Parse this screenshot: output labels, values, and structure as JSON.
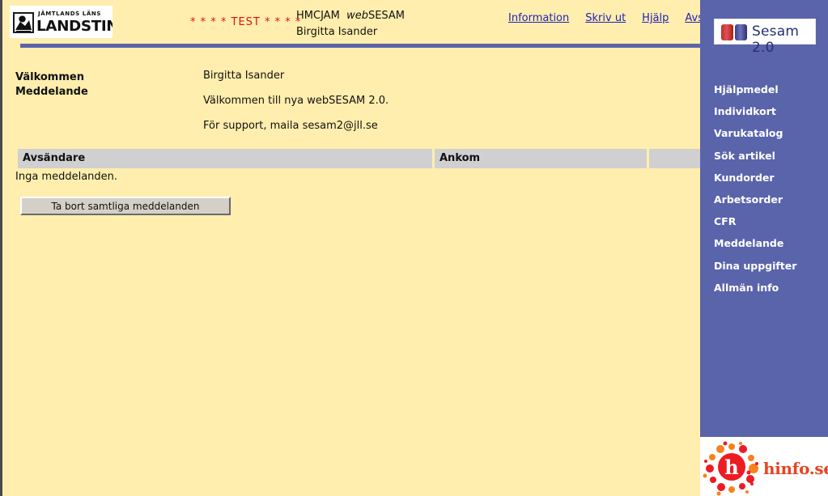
{
  "header": {
    "logo": {
      "line_top": "JÄMTLANDS LÄNS",
      "line_main": "LANDSTING",
      "icon": "landsting-emblem-icon"
    },
    "test_banner": "* * * *  TEST  * * * *",
    "unit_code": "HMCJAM",
    "app_name_italic": "web",
    "app_name_rest": "SESAM",
    "user_name": "Birgitta Isander",
    "nav_links": [
      {
        "label": "Information",
        "name": "nav-link-information"
      },
      {
        "label": "Skriv ut",
        "name": "nav-link-skriv-ut"
      },
      {
        "label": "Hjälp",
        "name": "nav-link-hjalp"
      },
      {
        "label": "Avsluta",
        "name": "nav-link-avsluta"
      }
    ]
  },
  "content": {
    "section_title_1": "Välkommen",
    "section_title_2": "Meddelande",
    "greeting": "Birgitta Isander",
    "welcome_line": "Välkommen till nya webSESAM 2.0.",
    "support_line": "För support, maila sesam2@jll.se",
    "table": {
      "columns": [
        "Avsändare",
        "Ankom",
        ""
      ],
      "rows": [],
      "empty_message": "Inga meddelanden."
    },
    "delete_all_button": "Ta bort samtliga meddelanden"
  },
  "sidebar": {
    "product_logo": "Sesam 2.0",
    "items": [
      {
        "label": "Hjälpmedel",
        "name": "sidebar-item-hjalpmedel"
      },
      {
        "label": "Individkort",
        "name": "sidebar-item-individkort"
      },
      {
        "label": "Varukatalog",
        "name": "sidebar-item-varukatalog"
      },
      {
        "label": "Sök artikel",
        "name": "sidebar-item-sok-artikel"
      },
      {
        "label": "Kundorder",
        "name": "sidebar-item-kundorder"
      },
      {
        "label": "Arbetsorder",
        "name": "sidebar-item-arbetsorder"
      },
      {
        "label": "CFR",
        "name": "sidebar-item-cfr"
      },
      {
        "label": "Meddelande",
        "name": "sidebar-item-meddelande"
      },
      {
        "label": "Dina uppgifter",
        "name": "sidebar-item-dina-uppgifter"
      },
      {
        "label": "Allmän info",
        "name": "sidebar-item-allman-info"
      }
    ]
  },
  "footer": {
    "hinfo_label": "hinfo.se",
    "hinfo_monogram": "h"
  },
  "colors": {
    "page_background": "#ffeead",
    "sidebar_blue": "#5a64ab",
    "test_red": "#dd1111",
    "link_blue": "#2222bb",
    "table_header_grey": "#d0d0d0",
    "button_face": "#d4d0c8",
    "hinfo_orange": "#e8441f"
  }
}
